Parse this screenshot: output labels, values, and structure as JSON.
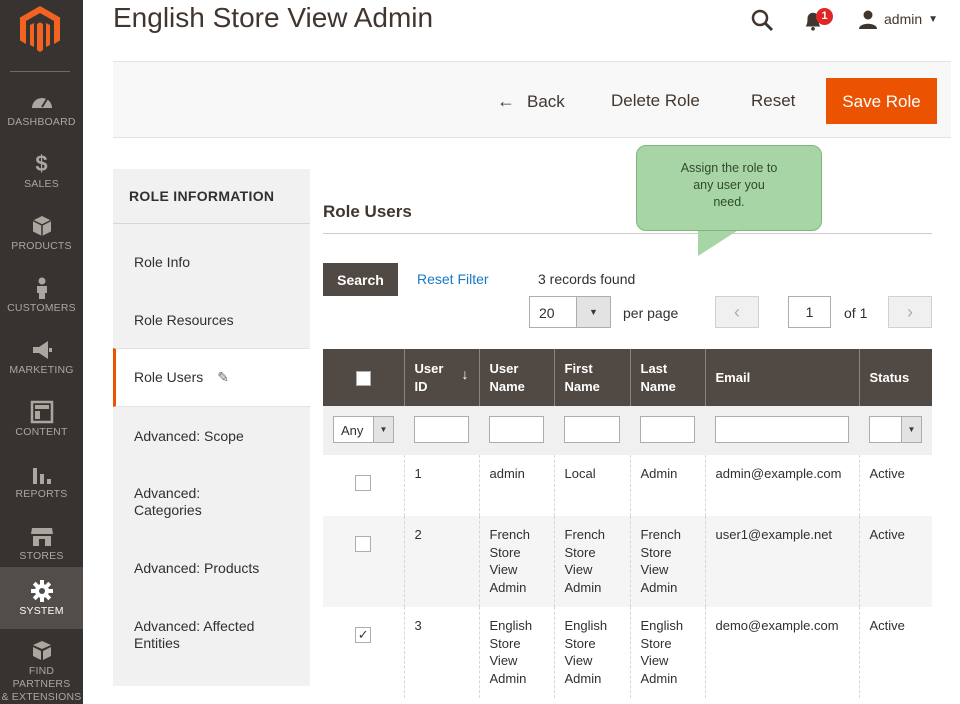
{
  "header": {
    "page_title": "English Store View Admin",
    "notifications_count": "1",
    "user_name": "admin"
  },
  "menu": {
    "items": [
      {
        "label": "DASHBOARD",
        "icon": "dashboard-icon"
      },
      {
        "label": "SALES",
        "icon": "dollar-icon"
      },
      {
        "label": "PRODUCTS",
        "icon": "box-icon"
      },
      {
        "label": "CUSTOMERS",
        "icon": "person-icon"
      },
      {
        "label": "MARKETING",
        "icon": "megaphone-icon"
      },
      {
        "label": "CONTENT",
        "icon": "layout-icon"
      },
      {
        "label": "REPORTS",
        "icon": "bar-chart-icon"
      },
      {
        "label": "STORES",
        "icon": "store-icon"
      },
      {
        "label": "SYSTEM",
        "icon": "gear-icon"
      },
      {
        "label_line1": "FIND PARTNERS",
        "label_line2": "& EXTENSIONS",
        "icon": "blocks-icon"
      }
    ],
    "active": "SYSTEM"
  },
  "actions": {
    "back": "Back",
    "delete": "Delete Role",
    "reset": "Reset",
    "save": "Save Role"
  },
  "tabs": {
    "title": "ROLE INFORMATION",
    "items": [
      {
        "label": "Role Info"
      },
      {
        "label": "Role Resources"
      },
      {
        "label": "Role Users"
      },
      {
        "label": "Advanced: Scope"
      },
      {
        "label_line1": "Advanced:",
        "label_line2": "Categories"
      },
      {
        "label": "Advanced: Products"
      },
      {
        "label_line1": "Advanced: Affected",
        "label_line2": "Entities"
      }
    ],
    "active": "Role Users"
  },
  "section": {
    "title": "Role Users"
  },
  "tooltip": {
    "text_line1": "Assign the role to",
    "text_line2": "any user you",
    "text_line3": "need."
  },
  "grid_controls": {
    "search": "Search",
    "reset_filter": "Reset Filter",
    "records_found": "3 records found",
    "per_page_value": "20",
    "per_page_label": "per page",
    "page_value": "1",
    "page_of": "of 1"
  },
  "grid": {
    "columns": [
      {
        "line1": "User",
        "line2": "ID"
      },
      {
        "line1": "User",
        "line2": "Name"
      },
      {
        "line1": "First",
        "line2": "Name"
      },
      {
        "line1": "Last",
        "line2": "Name"
      },
      {
        "line1": "Email"
      },
      {
        "line1": "Status"
      }
    ],
    "filter_any": "Any",
    "rows": [
      {
        "checked": false,
        "id": "1",
        "username": [
          "admin"
        ],
        "first": [
          "Local"
        ],
        "last": [
          "Admin"
        ],
        "email": "admin@example.com",
        "status": "Active"
      },
      {
        "checked": false,
        "id": "2",
        "username": [
          "French",
          "Store",
          "View",
          "Admin"
        ],
        "first": [
          "French",
          "Store",
          "View",
          "Admin"
        ],
        "last": [
          "French",
          "Store",
          "View",
          "Admin"
        ],
        "email": "user1@example.net",
        "status": "Active"
      },
      {
        "checked": true,
        "id": "3",
        "username": [
          "English",
          "Store",
          "View",
          "Admin"
        ],
        "first": [
          "English",
          "Store",
          "View",
          "Admin"
        ],
        "last": [
          "English",
          "Store",
          "View",
          "Admin"
        ],
        "email": "demo@example.com",
        "status": "Active"
      }
    ]
  },
  "colors": {
    "accent": "#eb5202",
    "menu_bg": "#373330",
    "grid_header": "#514943",
    "link": "#1979c3",
    "tooltip_bg": "#a8d5a5"
  }
}
